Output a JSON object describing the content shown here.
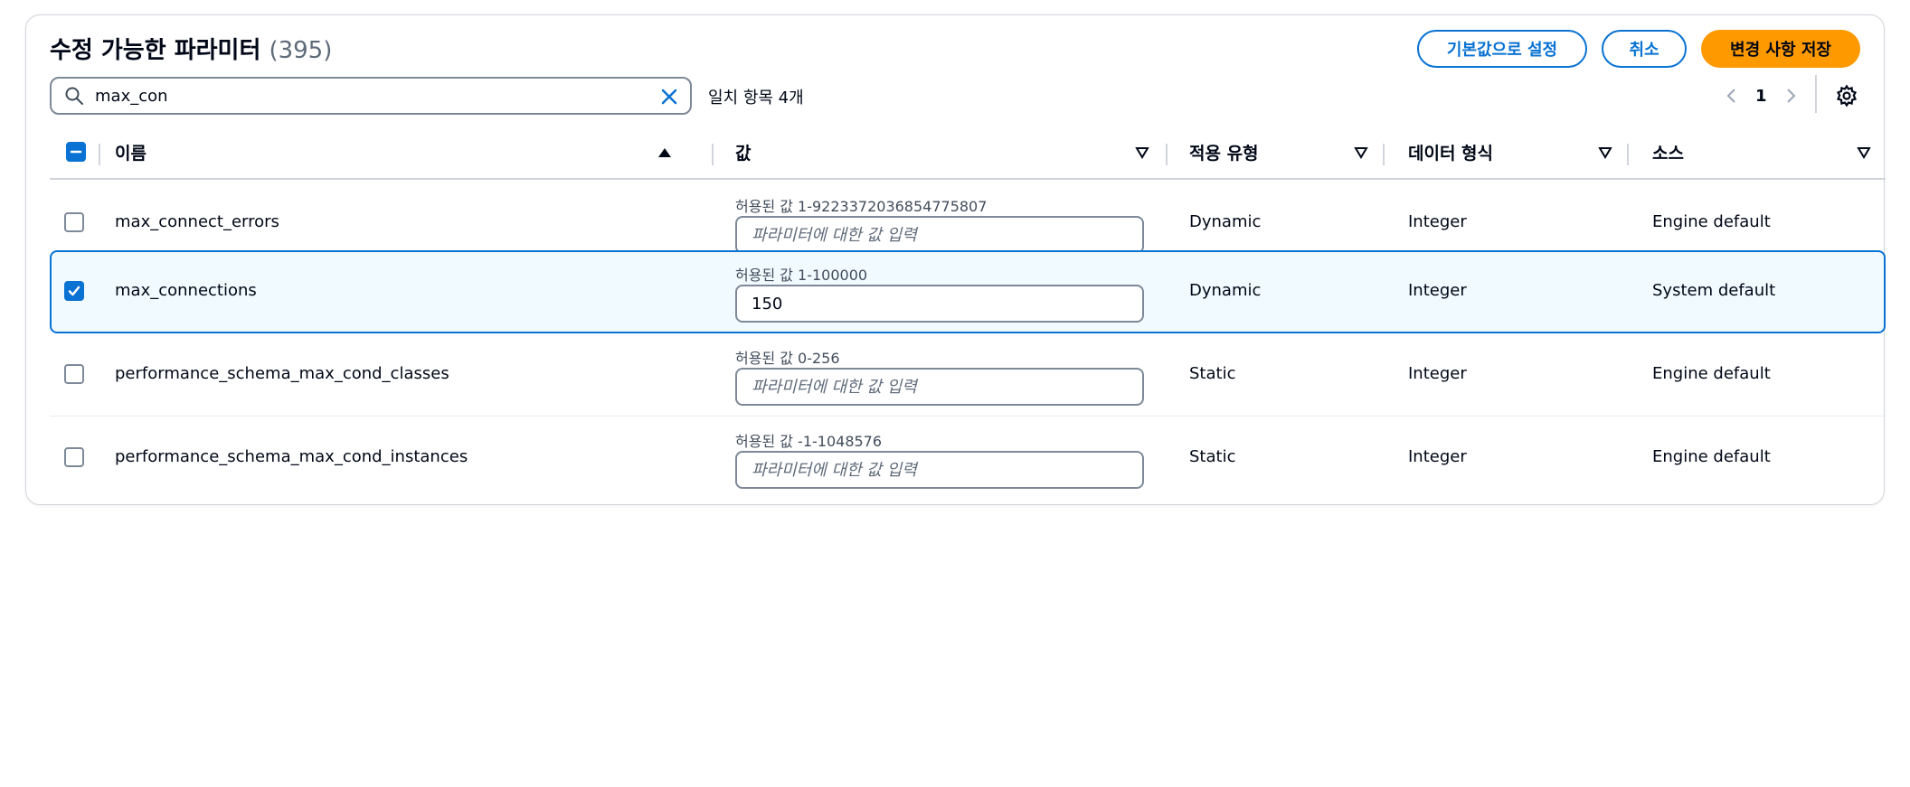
{
  "header": {
    "title": "수정 가능한 파라미터",
    "count": "(395)",
    "reset_label": "기본값으로 설정",
    "cancel_label": "취소",
    "save_label": "변경 사항 저장"
  },
  "search": {
    "value": "max_con",
    "match_text": "일치 항목 4개"
  },
  "pagination": {
    "current_page": "1"
  },
  "table": {
    "columns": [
      "이름",
      "값",
      "적용 유형",
      "데이터 형식",
      "소스"
    ],
    "value_placeholder": "파라미터에 대한 값 입력",
    "rows": [
      {
        "name": "max_connect_errors",
        "allowed": "허용된 값 1-9223372036854775807",
        "value": "",
        "apply_type": "Dynamic",
        "data_type": "Integer",
        "source": "Engine default",
        "selected": false
      },
      {
        "name": "max_connections",
        "allowed": "허용된 값 1-100000",
        "value": "150",
        "apply_type": "Dynamic",
        "data_type": "Integer",
        "source": "System default",
        "selected": true
      },
      {
        "name": "performance_schema_max_cond_classes",
        "allowed": "허용된 값 0-256",
        "value": "",
        "apply_type": "Static",
        "data_type": "Integer",
        "source": "Engine default",
        "selected": false
      },
      {
        "name": "performance_schema_max_cond_instances",
        "allowed": "허용된 값 -1-1048576",
        "value": "",
        "apply_type": "Static",
        "data_type": "Integer",
        "source": "Engine default",
        "selected": false
      }
    ]
  },
  "colors": {
    "accent": "#0972d3",
    "primary_button": "#ff9900",
    "selected_row_bg": "#f1faff"
  }
}
